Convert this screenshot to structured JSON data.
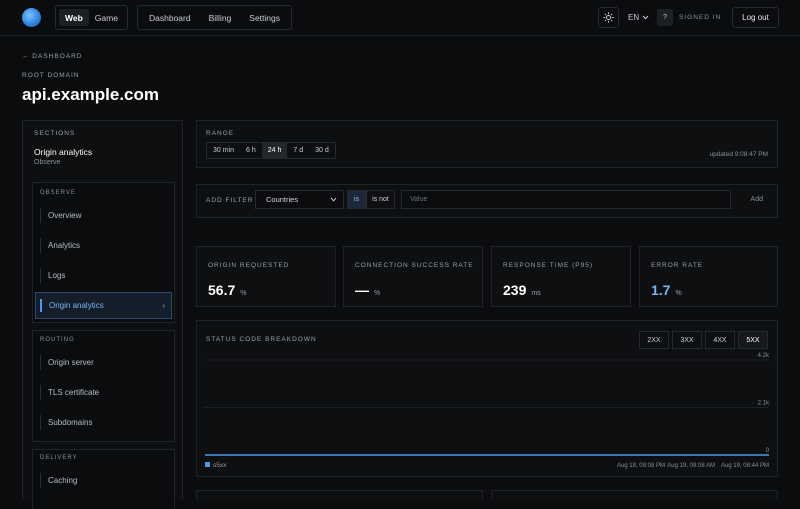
{
  "topbar": {
    "mode_tabs": [
      "Web",
      "Game"
    ],
    "nav": [
      "Dashboard",
      "Billing",
      "Settings"
    ],
    "lang": "EN",
    "help": "?",
    "signed_in": "SIGNED IN",
    "logout": "Log out"
  },
  "header": {
    "breadcrumb": "← DASHBOARD",
    "domain_label": "ROOT DOMAIN",
    "title": "api.example.com"
  },
  "sidebar": {
    "heading": "SECTIONS",
    "current": "Origin analytics",
    "current_sub": "Observe",
    "groups": [
      {
        "title": "OBSERVE",
        "items": [
          "Overview",
          "Analytics",
          "Logs",
          "Origin analytics"
        ],
        "active": "Origin analytics"
      },
      {
        "title": "ROUTING",
        "items": [
          "Origin server",
          "TLS certificate",
          "Subdomains"
        ]
      },
      {
        "title": "DELIVERY",
        "items": [
          "Caching"
        ]
      }
    ]
  },
  "range": {
    "label": "RANGE",
    "options": [
      "30 min",
      "6 h",
      "24 h",
      "7 d",
      "30 d"
    ],
    "selected": "24 h",
    "updated": "updated 9:08:47 PM"
  },
  "filter": {
    "label": "ADD FILTER",
    "field": "Countries",
    "ops": [
      "is",
      "is not"
    ],
    "selected_op": "is",
    "value_placeholder": "Value",
    "add": "Add"
  },
  "stats": [
    {
      "label": "ORIGIN REQUESTED",
      "value": "56.7",
      "unit": "%"
    },
    {
      "label": "CONNECTION SUCCESS RATE",
      "value": "—",
      "unit": "%"
    },
    {
      "label": "RESPONSE TIME (P95)",
      "value": "239",
      "unit": "ms"
    },
    {
      "label": "ERROR RATE",
      "value": "1.7",
      "unit": "%"
    }
  ],
  "chart_panel": {
    "title": "STATUS CODE BREAKDOWN",
    "buttons": [
      "2XX",
      "3XX",
      "4XX",
      "5XX"
    ],
    "selected": "5XX"
  },
  "chart_data": {
    "type": "line",
    "title": "STATUS CODE BREAKDOWN",
    "x": [
      "Aug 18, 09:08 PM",
      "Aug 19, 09:08 AM",
      "Aug 19, 08:44 PM"
    ],
    "yticks": [
      "4.2k",
      "2.1k",
      "0"
    ],
    "ylim": [
      0,
      4200
    ],
    "series": [
      {
        "name": "s5xx",
        "values": [
          0,
          0,
          0
        ]
      }
    ],
    "legend": "bottom-left",
    "grid": true
  },
  "colors": {
    "accent": "#4a9af0",
    "series": "#4a9af0",
    "background": "#0b0c0e",
    "panel": "#0e0f11"
  }
}
